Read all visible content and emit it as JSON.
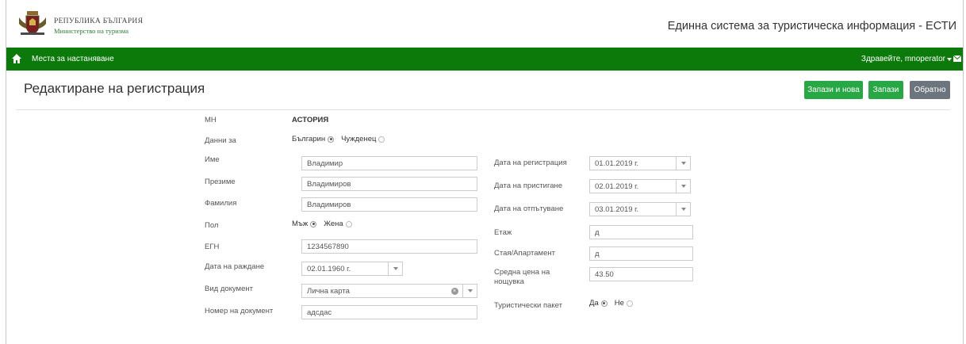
{
  "header": {
    "org_line1": "РЕПУБЛИКА БЪЛГАРИЯ",
    "org_line2": "Министерство на туризма",
    "system_title": "Единна система за туристическа информация - ЕСТИ"
  },
  "navbar": {
    "link": "Места за настаняване",
    "greeting": "Здравейте, mnoperator"
  },
  "toolbar": {
    "title": "Редактиране на регистрация",
    "save_and_new": "Запази и нова",
    "save": "Запази",
    "back": "Обратно"
  },
  "form": {
    "mn_label": "МН",
    "mn_value": "АСТОРИЯ",
    "data_for_label": "Данни за",
    "data_for_options": [
      "Българин",
      "Чужденец"
    ],
    "first_name_label": "Име",
    "first_name_value": "Владимир",
    "middle_name_label": "Презиме",
    "middle_name_value": "Владимиров",
    "last_name_label": "Фамилия",
    "last_name_value": "Владимиров",
    "gender_label": "Пол",
    "gender_options": [
      "Мъж",
      "Жена"
    ],
    "egn_label": "ЕГН",
    "egn_value": "1234567890",
    "birth_date_label": "Дата на раждане",
    "birth_date_value": "02.01.1960 г.",
    "doc_type_label": "Вид документ",
    "doc_type_value": "Лична карта",
    "doc_number_label": "Номер на документ",
    "doc_number_value": "адсдас",
    "reg_date_label": "Дата на регистрация",
    "reg_date_value": "01.01.2019 г.",
    "arrival_label": "Дата на пристигане",
    "arrival_value": "02.01.2019 г.",
    "departure_label": "Дата на отпътуване",
    "departure_value": "03.01.2019 г.",
    "floor_label": "Етаж",
    "floor_value": "д",
    "room_label": "Стая/Апартамент",
    "room_value": "д",
    "avg_price_label_1": "Средна цена на",
    "avg_price_label_2": "нощувка",
    "avg_price_value": "43.50",
    "package_label": "Туристически пакет",
    "package_options": [
      "Да",
      "Не"
    ]
  },
  "colors": {
    "navbar": "#0b7a0b",
    "button_green": "#28a745",
    "button_gray": "#6c757d"
  }
}
